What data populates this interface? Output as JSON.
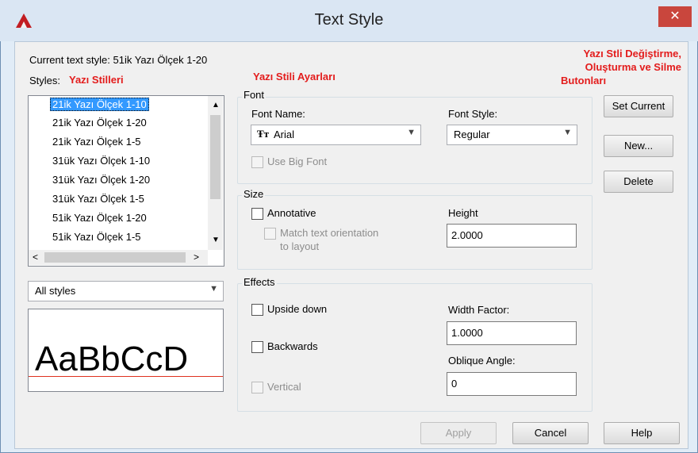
{
  "window": {
    "title": "Text Style",
    "close_glyph": "✕"
  },
  "current_style": {
    "label": "Current text style:",
    "value": "51ik Yazı Ölçek 1-20"
  },
  "styles": {
    "label": "Styles:",
    "annotation": "Yazı Stilleri",
    "items": [
      "21ik Yazı Ölçek 1-10",
      "21ik Yazı Ölçek 1-20",
      "21ik Yazı Ölçek 1-5",
      "31ük Yazı Ölçek 1-10",
      "31ük Yazı Ölçek 1-20",
      "31ük Yazı Ölçek 1-5",
      "51ik Yazı Ölçek 1-20",
      "51ik Yazı Ölçek 1-5"
    ],
    "filter_value": "All styles"
  },
  "annotations": {
    "settings": "Yazı Stili Ayarları",
    "buttons_line1": "Yazı Stli Değiştirme,",
    "buttons_line2": "Oluşturma ve Silme",
    "buttons_line3": "Butonları"
  },
  "font": {
    "group_label": "Font",
    "font_name_label": "Font Name:",
    "font_name_value": "Arial",
    "font_style_label": "Font Style:",
    "font_style_value": "Regular",
    "big_font_label": "Use Big Font"
  },
  "size": {
    "group_label": "Size",
    "annotative_label": "Annotative",
    "match_label_1": "Match text orientation",
    "match_label_2": "to layout",
    "height_label": "Height",
    "height_value": "2.0000"
  },
  "effects": {
    "group_label": "Effects",
    "upside_down_label": "Upside down",
    "backwards_label": "Backwards",
    "vertical_label": "Vertical",
    "width_factor_label": "Width Factor:",
    "width_factor_value": "1.0000",
    "oblique_label": "Oblique Angle:",
    "oblique_value": "0"
  },
  "preview": {
    "text": "AaBbCcD"
  },
  "buttons": {
    "set_current": "Set Current",
    "new": "New...",
    "delete": "Delete",
    "apply": "Apply",
    "cancel": "Cancel",
    "help": "Help"
  },
  "colors": {
    "annotation_red": "#e31c1c",
    "close_red": "#c9463d",
    "selection_blue": "#3399ff"
  }
}
